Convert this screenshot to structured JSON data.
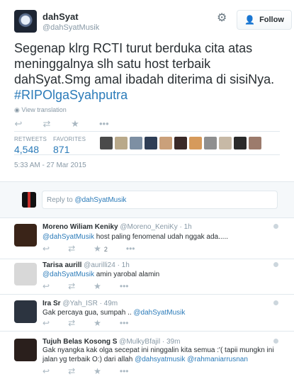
{
  "tweet": {
    "name": "dahSyat",
    "handle": "@dahSyatMusik",
    "follow_label": "Follow",
    "text_main": "Segenap klrg RCTI turut berduka cita atas meninggalnya slh satu host terbaik dahSyat.Smg amal ibadah diterima di sisiNya. ",
    "hashtag": "#RIPOlgaSyahputra",
    "view_translation": "View translation",
    "retweets_label": "RETWEETS",
    "retweets_value": "4,548",
    "favorites_label": "FAVORITES",
    "favorites_value": "871",
    "timestamp": "5:33 AM - 27 Mar 2015",
    "fav_avatar_colors": [
      "#4a4a4a",
      "#b9a98a",
      "#7d8fa3",
      "#2f3e56",
      "#caa07a",
      "#3b2a28",
      "#d69a5b",
      "#8f8f8f",
      "#c7b9a6",
      "#2a2a2a",
      "#9c7b6c"
    ]
  },
  "reply_box": {
    "prefix": "Reply to ",
    "mention": "@dahSyatMusik"
  },
  "replies": [
    {
      "name": "Moreno Wiliam Keniky",
      "meta": " @Moreno_KeniKy · 1h",
      "mention": "@dahSyatMusik",
      "text": " host paling fenomenal udah nggak ada.....",
      "count": "2",
      "avatar_color": "#3a2418"
    },
    {
      "name": "Tarisa aurill",
      "meta": " @aurilli24 · 1h",
      "mention": "@dahSyatMusik",
      "text": " amin yarobal alamin",
      "count": "",
      "avatar_color": "#d8d8d8"
    },
    {
      "name": "Ira Sr",
      "meta": " @Yah_ISR · 49m",
      "mention": "@dahSyatMusik",
      "text_before": "Gak percaya gua, sumpah .. ",
      "count": "",
      "avatar_color": "#2c3440"
    },
    {
      "name": "Tujuh Belas Kosong S",
      "meta": " @MulkyBfajil · 39m",
      "text_before": "Gak nyangka kak olga secepat ini ninggalin kita semua :'( tapii mungkn ini jalan yg terbaik O:) dari allah ",
      "mention": "@dahsyatmusik",
      "mention2": "@rahmaniarrusnan",
      "count": "",
      "avatar_color": "#2a1f1c"
    }
  ],
  "icons": {
    "reply": "reply-icon",
    "retweet": "retweet-icon",
    "favorite": "star-icon",
    "more": "more-icon",
    "gear": "gear-icon"
  }
}
